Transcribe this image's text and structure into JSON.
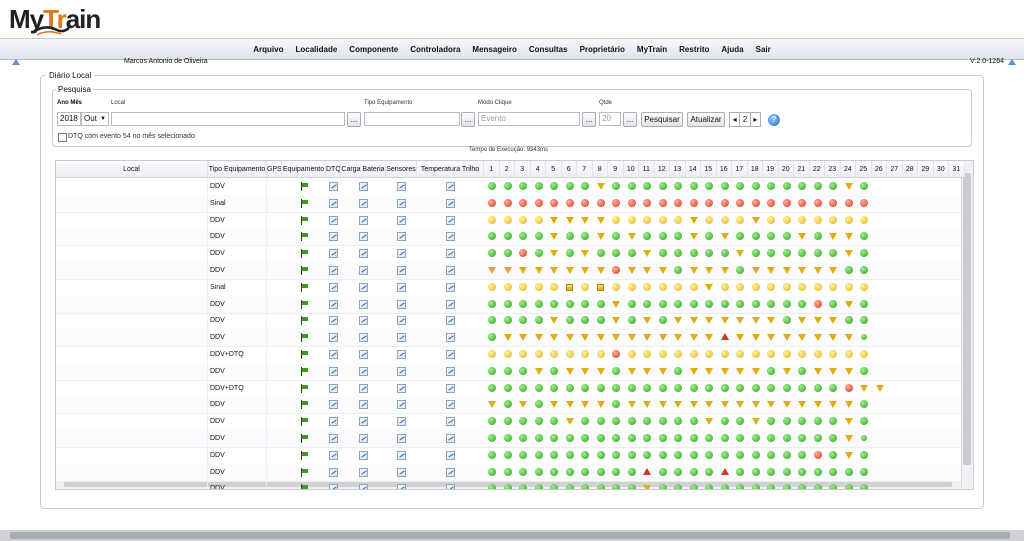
{
  "app": {
    "logo_left": "My",
    "logo_accent": "Tr",
    "logo_right": "ain",
    "version": "V:2.0-1264",
    "user": "Marcos Antonio de Oliveira"
  },
  "nav": [
    "Arquivo",
    "Localidade",
    "Componente",
    "Controladora",
    "Mensageiro",
    "Consultas",
    "Proprietário",
    "MyTrain",
    "Restrito",
    "Ajuda",
    "Sair"
  ],
  "panel": {
    "title": "Diário Local",
    "search_title": "Pesquisa"
  },
  "search": {
    "ano_mes_label": "Ano Mês",
    "ano": "2018",
    "mes": "Out",
    "local_label": "Local",
    "local_value": "",
    "tipo_label": "Tipo Equipamento",
    "tipo_value": "",
    "modo_label": "Modo Clique",
    "modo_placeholder": "Evento",
    "qtde_label": "Qtde",
    "qtde_placeholder": "20",
    "ellipsis": "...",
    "pesquisar": "Pesquisar",
    "atualizar": "Atualizar",
    "page": "2",
    "prev": "◂",
    "next": "▸",
    "help": "?",
    "dtq_checkbox": "DTQ com evento 54 no mês selecionado",
    "exec_time": "Tempo de Execução: 9343ms"
  },
  "table": {
    "headers": [
      "Local",
      "Tipo Equipamento",
      "GPS",
      "Equipamento",
      "DTQ",
      "Carga Bateria",
      "Sensores",
      "Temperatura Trilho"
    ],
    "days": [
      "1",
      "2",
      "3",
      "4",
      "5",
      "6",
      "7",
      "8",
      "9",
      "10",
      "11",
      "12",
      "13",
      "14",
      "15",
      "16",
      "17",
      "18",
      "19",
      "20",
      "21",
      "22",
      "23",
      "24",
      "25",
      "26",
      "27",
      "28",
      "29",
      "30",
      "31"
    ],
    "legend_codes": {
      "g": "green-circle",
      "y": "yellow-circle",
      "r": "red-circle",
      "s": "small-green-circle",
      "v": "yellow-down-triangle",
      "V": "red-down-triangle",
      "t": "red-up-triangle",
      "q": "yellow-square"
    },
    "rows": [
      {
        "tipo": "DDV",
        "marks": "gggggggvgggggggggggggggvg"
      },
      {
        "tipo": "Sinal",
        "marks": "rrrrrrrrrrrrrrrrrrrrrrrrr"
      },
      {
        "tipo": "DDV",
        "marks": "yyyyvvvvyyyyyvyyyvyyyyyyy"
      },
      {
        "tipo": "DDV",
        "marks": "ggggvggvgvgggvgvggggvgvvg"
      },
      {
        "tipo": "DDV",
        "marks": "ggrgvgvgggvgggggvggggggvg"
      },
      {
        "tipo": "DDV",
        "marks": "vvvvvvvvrvvvgvvvgvvvvvvgg"
      },
      {
        "tipo": "Sinal",
        "marks": "yyyyyqyqyyyyyyvyyyyyyyyyy"
      },
      {
        "tipo": "DDV",
        "marks": "ggggggggvggggggggggggrgvg"
      },
      {
        "tipo": "DDV",
        "marks": "ggggvgggvgvgvvvvvvvgvvvgg"
      },
      {
        "tipo": "DDV",
        "marks": "gvvvvvvvvvvvvvvtvvvvvvvvs"
      },
      {
        "tipo": "DDV+DTQ",
        "marks": "yyyyyyyyryyyyyyyyyyyyyyyy"
      },
      {
        "tipo": "DDV",
        "marks": "gggvgvvvgvvvgvvvvvgvgvvvg"
      },
      {
        "tipo": "DDV+DTQ",
        "marks": "gggggggggggggggggggggggrvv"
      },
      {
        "tipo": "DDV",
        "marks": "vgvgvvvvgvvvvvvvvvvvvvvvg"
      },
      {
        "tipo": "DDV",
        "marks": "gggggvggggggggvggvgggggvg"
      },
      {
        "tipo": "DDV",
        "marks": "gggggggggggggggggggggggvs"
      },
      {
        "tipo": "DDV",
        "marks": "gggggggggggggggggggggrgvg"
      },
      {
        "tipo": "DDV",
        "marks": "ggggggggggtggggtggggggggg"
      },
      {
        "tipo": "DDV",
        "marks": "ggggggggggvgggggggggggggg"
      }
    ]
  }
}
